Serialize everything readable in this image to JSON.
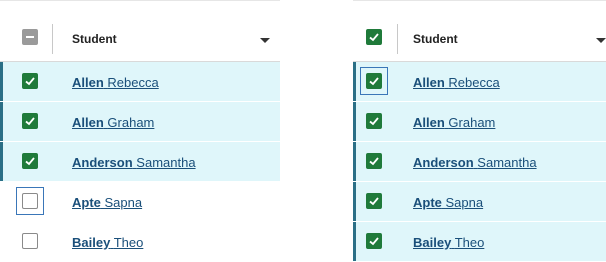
{
  "left_panel": {
    "header": {
      "label": "Student",
      "select_all_state": "indeterminate"
    },
    "rows": [
      {
        "last": "Allen",
        "first": "Rebecca",
        "checked": true
      },
      {
        "last": "Allen",
        "first": "Graham",
        "checked": true
      },
      {
        "last": "Anderson",
        "first": "Samantha",
        "checked": true
      },
      {
        "last": "Apte",
        "first": "Sapna",
        "checked": false,
        "focused": true
      },
      {
        "last": "Bailey",
        "first": "Theo",
        "checked": false
      }
    ]
  },
  "right_panel": {
    "header": {
      "label": "Student",
      "select_all_state": "checked"
    },
    "rows": [
      {
        "last": "Allen",
        "first": "Rebecca",
        "checked": true,
        "focused": true
      },
      {
        "last": "Allen",
        "first": "Graham",
        "checked": true
      },
      {
        "last": "Anderson",
        "first": "Samantha",
        "checked": true
      },
      {
        "last": "Apte",
        "first": "Sapna",
        "checked": true
      },
      {
        "last": "Bailey",
        "first": "Theo",
        "checked": true
      }
    ]
  },
  "colors": {
    "checked": "#1f7a3a",
    "selected_row": "#dff6fa",
    "row_accent": "#2a6f86",
    "link": "#1a4f7a",
    "focus": "#3a76b8"
  },
  "icons": {
    "check": "checkmark-icon",
    "indeterminate": "minus-icon",
    "sort": "caret-down-icon"
  }
}
